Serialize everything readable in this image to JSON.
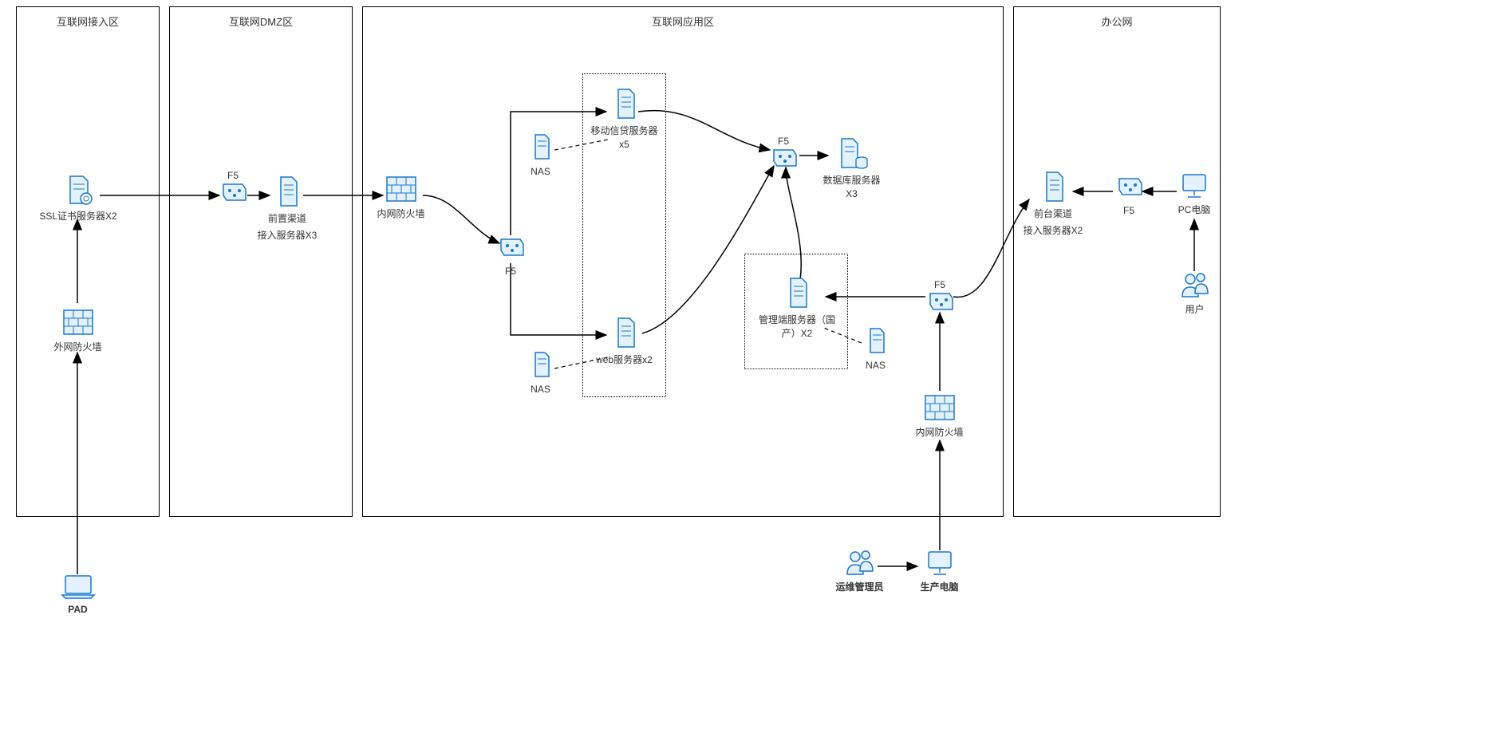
{
  "zones": {
    "access": "互联网接入区",
    "dmz": "互联网DMZ区",
    "app": "互联网应用区",
    "office": "办公网"
  },
  "nodes": {
    "pad": "PAD",
    "ext_fw": "外网防火墙",
    "ssl": "SSL证书服务器X2",
    "f5_dmz": "F5",
    "front_channel": "前置渠道",
    "front_channel2": "接入服务器X3",
    "int_fw": "内网防火墙",
    "f5_left": "F5",
    "nas1": "NAS",
    "mobile_loan": "移动信贷服务器x5",
    "nas2": "NAS",
    "web_server": "web服务器x2",
    "f5_top": "F5",
    "db_server": "数据库服务器X3",
    "mgmt_server": "管理端服务器（国产）X2",
    "nas3": "NAS",
    "f5_right": "F5",
    "int_fw2": "内网防火墙",
    "ops_admin": "运维管理员",
    "prod_pc": "生产电脑",
    "front_desk": "前台渠道",
    "front_desk2": "接入服务器X2",
    "f5_office": "F5",
    "pc": "PC电脑",
    "user": "用户"
  },
  "colors": {
    "icon_stroke": "#1976D2",
    "icon_fill": "#E3F2FD"
  }
}
